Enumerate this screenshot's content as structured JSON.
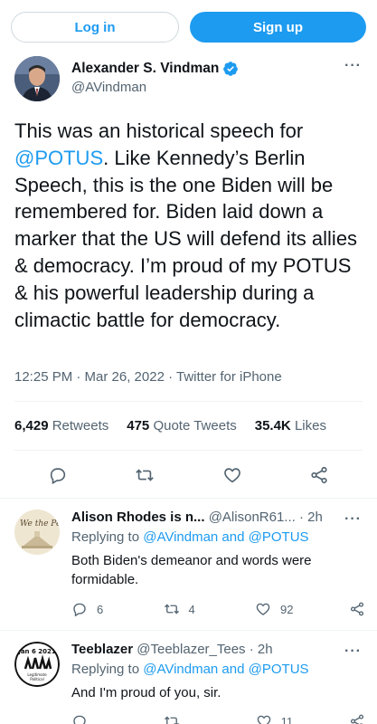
{
  "header": {
    "login_label": "Log in",
    "signup_label": "Sign up"
  },
  "tweet": {
    "author_name": "Alexander S. Vindman",
    "author_handle": "@AVindman",
    "text_part1": "This was an historical speech for ",
    "mention": "@POTUS",
    "text_part2": ". Like Kennedy’s Berlin Speech, this is the one Biden will be remembered for. Biden laid down a marker that the US will defend its allies & democracy. I’m proud of my POTUS & his powerful leadership during a climactic battle for democracy.",
    "meta": "12:25 PM · Mar 26, 2022 · Twitter for iPhone",
    "stats": {
      "retweets_count": "6,429",
      "retweets_label": "Retweets",
      "quotes_count": "475",
      "quotes_label": "Quote Tweets",
      "likes_count": "35.4K",
      "likes_label": "Likes"
    }
  },
  "replies": [
    {
      "name": "Alison Rhodes is n...",
      "handle": "@AlisonR61...",
      "time": "· 2h",
      "replying_prefix": "Replying to ",
      "replying_users": "@AVindman and @POTUS",
      "text": "Both Biden's demeanor and words were formidable.",
      "reply_count": "6",
      "retweet_count": "4",
      "like_count": "92"
    },
    {
      "name": "Teeblazer",
      "handle": "@Teeblazer_Tees",
      "time": "· 2h",
      "replying_prefix": "Replying to ",
      "replying_users": "@AVindman and @POTUS",
      "text": "And I'm proud of you, sir.",
      "reply_count": "",
      "retweet_count": "",
      "like_count": "11"
    }
  ],
  "colors": {
    "accent": "#1d9bf0",
    "text": "#0f1419",
    "secondary": "#536471"
  }
}
